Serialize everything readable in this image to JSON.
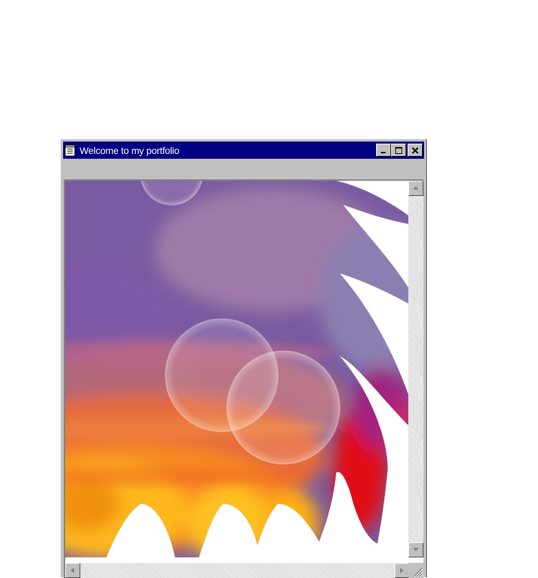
{
  "window": {
    "title": "Welcome to my portfolio",
    "title_icon": "notepad-icon",
    "caption_buttons": [
      "minimize-icon",
      "maximize-icon",
      "close-icon"
    ]
  },
  "content": {
    "image": "abstract-swirl-artwork",
    "colors": {
      "purple": "#6e4b9a",
      "mauve": "#a27fa8",
      "orange": "#f07a20",
      "yellow": "#ffcc00",
      "red": "#e00018",
      "titlebar": "#000080"
    }
  },
  "scrollbars": {
    "vertical": [
      "scroll-up-arrow-icon",
      "scroll-down-arrow-icon"
    ],
    "horizontal": [
      "scroll-left-arrow-icon",
      "scroll-right-arrow-icon"
    ]
  }
}
